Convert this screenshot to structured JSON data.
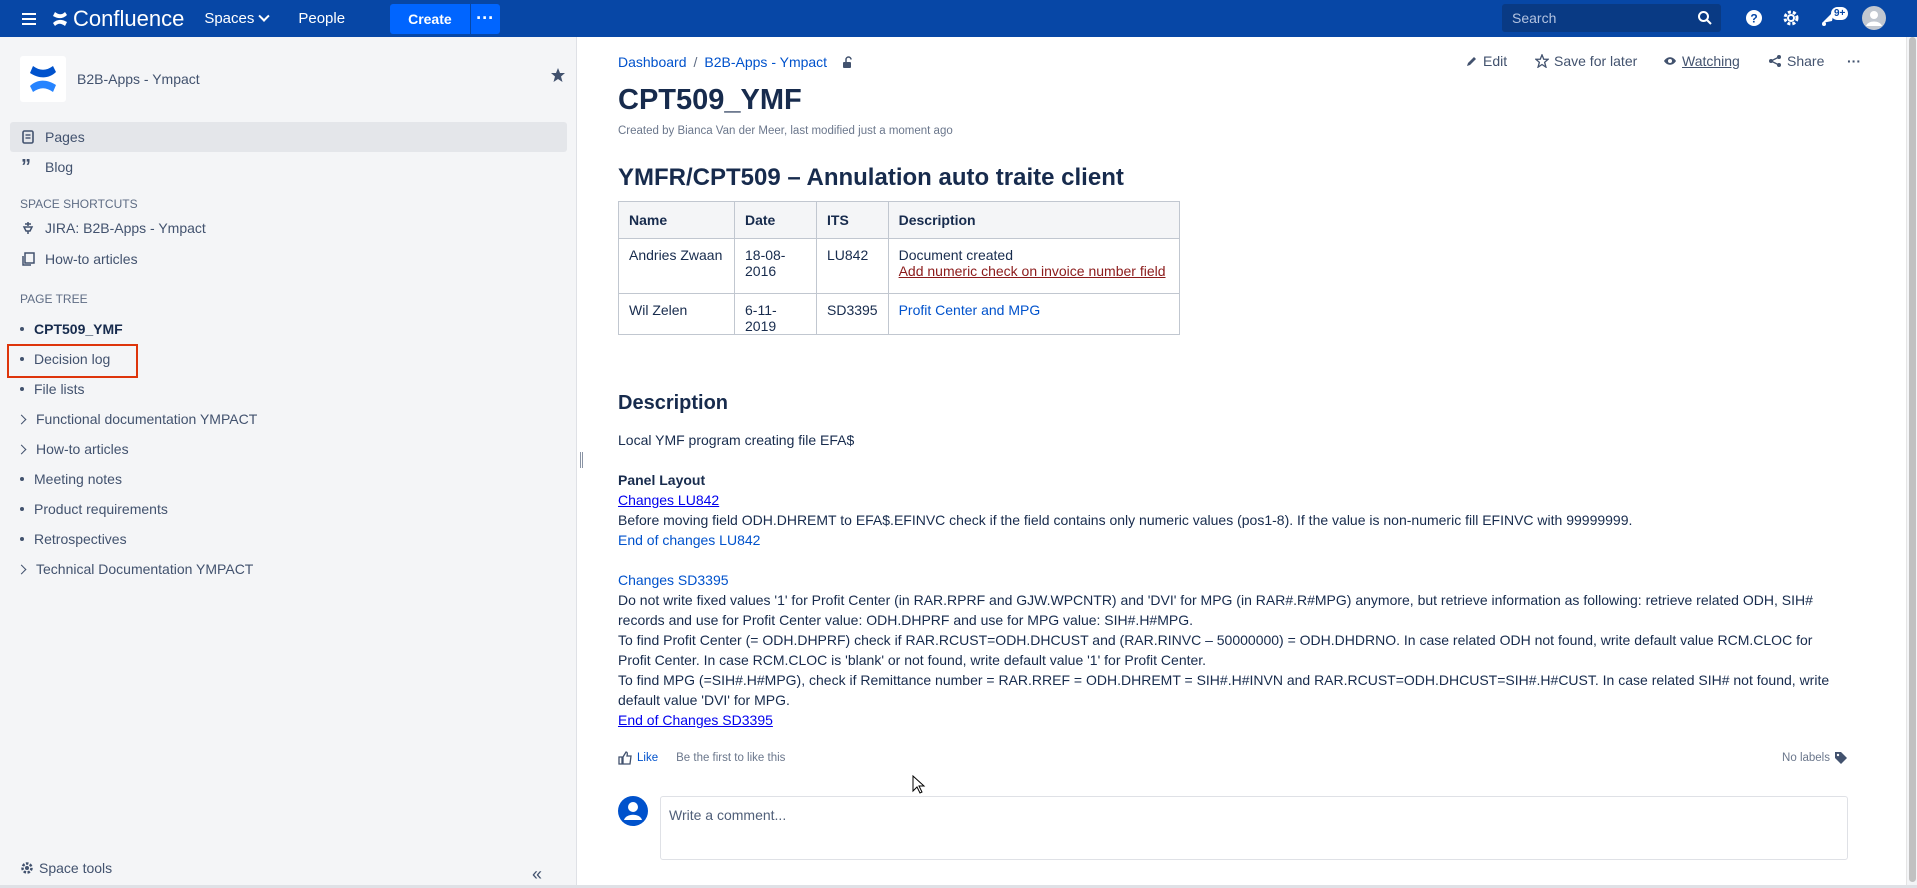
{
  "topnav": {
    "logo": "Confluence",
    "spaces": "Spaces",
    "people": "People",
    "create": "Create",
    "more": "···",
    "search_placeholder": "Search",
    "notif_badge": "9+"
  },
  "sidebar": {
    "space_name": "B2B-Apps - Ympact",
    "nav": [
      {
        "label": "Pages"
      },
      {
        "label": "Blog"
      }
    ],
    "shortcuts_heading": "SPACE SHORTCUTS",
    "shortcuts": [
      {
        "label": "JIRA: B2B-Apps - Ympact"
      },
      {
        "label": "How-to articles"
      }
    ],
    "tree_heading": "PAGE TREE",
    "tree": [
      {
        "label": "CPT509_YMF"
      },
      {
        "label": "Decision log"
      },
      {
        "label": "File lists"
      },
      {
        "label": "Functional documentation YMPACT"
      },
      {
        "label": "How-to articles"
      },
      {
        "label": "Meeting notes"
      },
      {
        "label": "Product requirements"
      },
      {
        "label": "Retrospectives"
      },
      {
        "label": "Technical Documentation YMPACT"
      }
    ],
    "space_tools": "Space tools"
  },
  "page": {
    "breadcrumbs": [
      "Dashboard",
      "B2B-Apps - Ympact"
    ],
    "actions": {
      "edit": "Edit",
      "save": "Save for later",
      "watching": "Watching",
      "share": "Share",
      "more": "···"
    },
    "title": "CPT509_YMF",
    "byline": "Created by Bianca Van der Meer, last modified just a moment ago",
    "heading": "YMFR/CPT509 – Annulation auto traite client",
    "table": {
      "headers": [
        "Name",
        "Date",
        "ITS",
        "Description"
      ],
      "rows": [
        {
          "name": "Andries Zwaan",
          "date": "18-08-2016",
          "its": "LU842",
          "desc1": "Document created",
          "desc2": "Add numeric check on invoice number field"
        },
        {
          "name": "Wil Zelen",
          "date": "6-11-2019",
          "its": "SD3395",
          "desc1": "Profit Center and MPG"
        }
      ]
    },
    "desc_heading": "Description",
    "desc_intro": "Local YMF program creating file EFA$",
    "panel_layout": "Panel Layout",
    "changes_lu842": "Changes LU842",
    "lu842_text": "Before moving field ODH.DHREMT to EFA$.EFINVC check if the field contains only numeric values (pos1-8). If the value is non-numeric fill EFINVC with 99999999.",
    "end_lu842": "End of changes LU842",
    "changes_sd3395": "Changes SD3395",
    "sd3395_p1": "Do not write fixed values '1' for Profit Center (in RAR.RPRF and GJW.WPCNTR) and 'DVI' for MPG (in RAR#.R#MPG) anymore, but retrieve information as following: retrieve related ODH, SIH# records and use for Profit Center value: ODH.DHPRF and use for MPG value: SIH#.H#MPG.",
    "sd3395_p2": "To find Profit Center (= ODH.DHPRF) check if RAR.RCUST=ODH.DHCUST and (RAR.RINVC – 50000000) = ODH.DHDRNO. In case related ODH not found, write default value RCM.CLOC for Profit Center. In case RCM.CLOC is 'blank' or not found, write default value '1' for Profit Center.",
    "sd3395_p3": "To find MPG (=SIH#.H#MPG), check if Remittance number = RAR.RREF = ODH.DHREMT = SIH#.H#INVN and RAR.RCUST=ODH.DHCUST=SIH#.H#CUST. In case related SIH# not found, write default value 'DVI' for MPG.",
    "end_sd3395": "End of Changes SD3395",
    "like": "Like",
    "be_first": "Be the first to like this",
    "no_labels": "No labels",
    "comment_placeholder": "Write a comment..."
  }
}
